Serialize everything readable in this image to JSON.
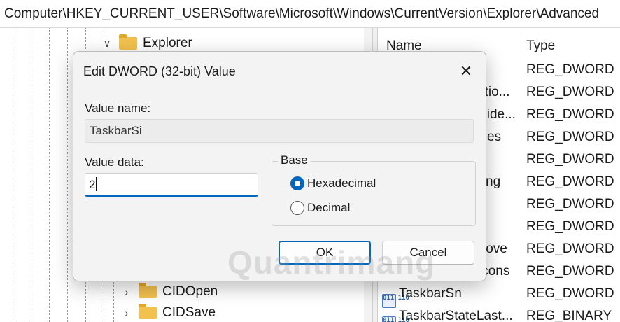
{
  "address_bar": {
    "path": "Computer\\HKEY_CURRENT_USER\\Software\\Microsoft\\Windows\\CurrentVersion\\Explorer\\Advanced"
  },
  "tree": {
    "items": [
      {
        "label": "Explorer",
        "expanded": true
      },
      {
        "label": "CIDOpen",
        "expanded": false
      },
      {
        "label": "CIDSave",
        "expanded": false
      }
    ]
  },
  "list": {
    "columns": {
      "name": "Name",
      "type": "Type"
    },
    "rows": [
      {
        "name": "",
        "type": "REG_DWORD"
      },
      {
        "name": "atio...",
        "type": "REG_DWORD"
      },
      {
        "name": "Hide...",
        "type": "REG_DWORD"
      },
      {
        "name": "es",
        "type": "REG_DWORD"
      },
      {
        "name": "",
        "type": "REG_DWORD"
      },
      {
        "name": "ng",
        "type": "REG_DWORD"
      },
      {
        "name": "",
        "type": "REG_DWORD"
      },
      {
        "name": "",
        "type": "REG_DWORD"
      },
      {
        "name": "love",
        "type": "REG_DWORD"
      },
      {
        "name": "lcons",
        "type": "REG_DWORD"
      },
      {
        "name": "TaskbarSn",
        "type": "REG_DWORD"
      },
      {
        "name": "TaskbarStateLast...",
        "type": "REG_BINARY"
      }
    ],
    "icon_glyph": "011 110"
  },
  "dialog": {
    "title": "Edit DWORD (32-bit) Value",
    "close_glyph": "✕",
    "value_name_label": "Value name:",
    "value_name": "TaskbarSi",
    "value_data_label": "Value data:",
    "value_data": "2",
    "base_label": "Base",
    "base_options": [
      {
        "label": "Hexadecimal",
        "selected": true
      },
      {
        "label": "Decimal",
        "selected": false
      }
    ],
    "ok_label": "OK",
    "cancel_label": "Cancel",
    "accent_color": "#0067c0"
  },
  "watermark": {
    "text": "Quantrimang"
  }
}
